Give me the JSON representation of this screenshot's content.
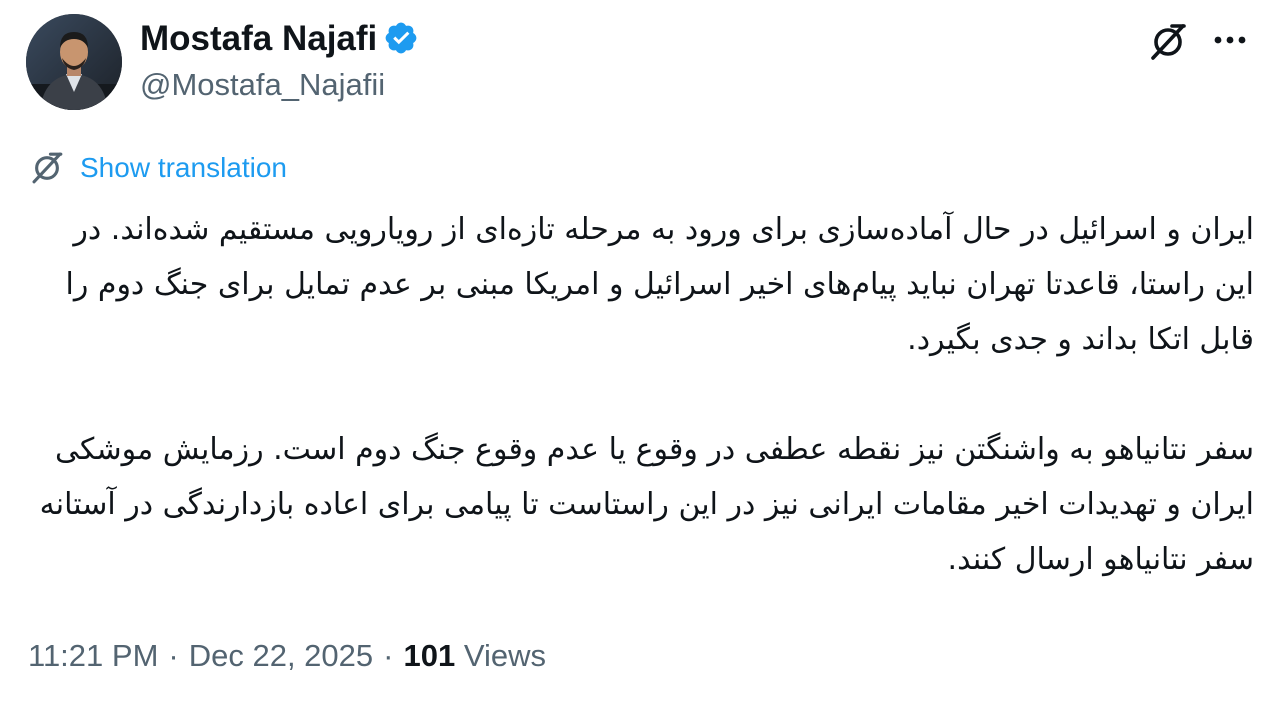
{
  "author": {
    "display_name": "Mostafa Najafi",
    "handle": "@Mostafa_Najafii",
    "verified": true,
    "avatar_icon": "user-avatar-photo"
  },
  "header": {
    "translate_icon": "translate-icon",
    "more_icon": "more-options-icon"
  },
  "translation": {
    "label": "Show translation",
    "icon": "translate-icon"
  },
  "tweet": {
    "paragraphs": [
      "ایران و اسرائیل در حال آماده‌سازی برای ورود به مرحله تازه‌ای از رویارویی مستقیم شده‌اند. در این راستا، قاعدتا تهران نباید پیام‌های اخیر اسرائیل و امریکا مبنی بر عدم تمایل برای جنگ دوم را قابل اتکا بداند و جدی بگیرد.",
      "سفر نتانیاهو به واشنگتن نیز نقطه عطفی در وقوع یا عدم وقوع جنگ دوم است. رزمایش موشکی ایران و تهدیدات اخیر مقامات ایرانی نیز در این راستاست تا پیامی برای اعاده بازدارندگی در آستانه سفر نتانیاهو ارسال کنند."
    ]
  },
  "meta": {
    "time": "11:21 PM",
    "separator": "·",
    "date": "Dec 22, 2025",
    "views_count": "101",
    "views_label": "Views"
  },
  "colors": {
    "link": "#1d9bf0",
    "secondary_text": "#536471",
    "primary_text": "#0f1419",
    "verified_badge": "#1d9bf0"
  }
}
